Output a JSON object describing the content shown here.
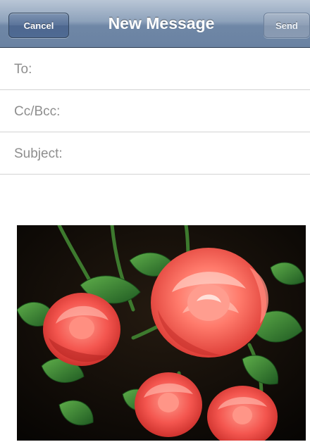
{
  "navbar": {
    "title": "New Message",
    "cancel_label": "Cancel",
    "send_label": "Send"
  },
  "fields": {
    "to_label": "To:",
    "cc_label": "Cc/Bcc:",
    "subject_label": "Subject:"
  },
  "attachment": {
    "icon": "rose-photo-icon",
    "subject": "red roses with green leaves"
  },
  "colors": {
    "navbar": "#6f87a6",
    "button": "#4f6a93",
    "label": "#8e8e8e",
    "divider": "#d3d3d3",
    "rose": "#f0554f"
  }
}
